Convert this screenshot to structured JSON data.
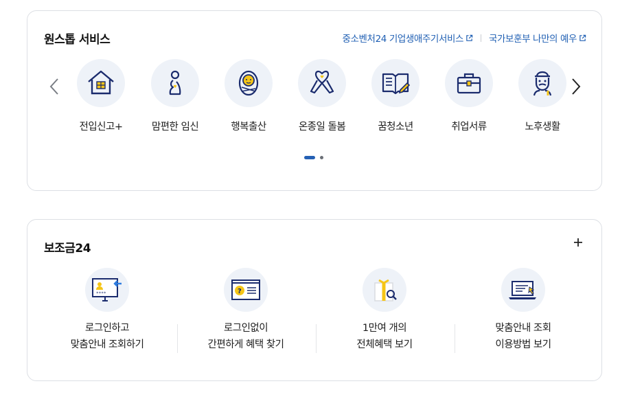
{
  "one_stop": {
    "title": "원스톱 서비스",
    "link1": "중소벤처24 기업생애주기서비스",
    "link2": "국가보훈부 나만의 예우",
    "services": [
      {
        "label": "전입신고+",
        "icon": "house-icon"
      },
      {
        "label": "맘편한 임신",
        "icon": "pregnancy-icon"
      },
      {
        "label": "행복출산",
        "icon": "baby-icon"
      },
      {
        "label": "온종일 돌봄",
        "icon": "ribbon-heart-icon"
      },
      {
        "label": "꿈청소년",
        "icon": "book-pencil-icon"
      },
      {
        "label": "취업서류",
        "icon": "briefcase-icon"
      },
      {
        "label": "노후생활",
        "icon": "elderly-icon"
      }
    ],
    "pagination": {
      "pages": 2,
      "current": 1
    }
  },
  "subsidy": {
    "title": "보조금24",
    "items": [
      {
        "line1": "로그인하고",
        "line2": "맞춤안내 조회하기",
        "icon": "login-monitor-icon"
      },
      {
        "line1": "로그인없이",
        "line2": "간편하게 혜택 찾기",
        "icon": "question-document-icon"
      },
      {
        "line1": "1만여 개의",
        "line2": "전체혜택 보기",
        "icon": "gift-search-icon"
      },
      {
        "line1": "맞춤안내 조회",
        "line2": "이용방법 보기",
        "icon": "laptop-guide-icon"
      }
    ]
  },
  "colors": {
    "accent": "#2560b4",
    "navy": "#1a2b6d",
    "yellow": "#f5c518",
    "icon_bg": "#eef2f8"
  }
}
